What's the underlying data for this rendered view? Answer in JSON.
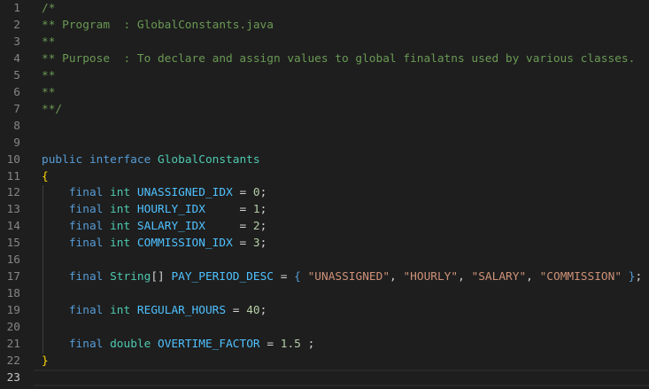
{
  "editor": {
    "active_line": 23,
    "lines": [
      [
        [
          "comment",
          "/*"
        ]
      ],
      [
        [
          "comment",
          "** Program  : GlobalConstants.java"
        ]
      ],
      [
        [
          "comment",
          "**"
        ]
      ],
      [
        [
          "comment",
          "** Purpose  : To declare and assign values to global finalatns used by various classes."
        ]
      ],
      [
        [
          "comment",
          "**"
        ]
      ],
      [
        [
          "comment",
          "**"
        ]
      ],
      [
        [
          "comment",
          "**/"
        ]
      ],
      [],
      [],
      [
        [
          "kw",
          "public"
        ],
        [
          "plain",
          " "
        ],
        [
          "kw",
          "interface"
        ],
        [
          "plain",
          " "
        ],
        [
          "type",
          "GlobalConstants"
        ]
      ],
      [
        [
          "brace",
          "{"
        ]
      ],
      [
        [
          "plain",
          "    "
        ],
        [
          "kw",
          "final"
        ],
        [
          "plain",
          " "
        ],
        [
          "type",
          "int"
        ],
        [
          "plain",
          " "
        ],
        [
          "const",
          "UNASSIGNED_IDX"
        ],
        [
          "plain",
          " = "
        ],
        [
          "num",
          "0"
        ],
        [
          "plain",
          ";"
        ]
      ],
      [
        [
          "plain",
          "    "
        ],
        [
          "kw",
          "final"
        ],
        [
          "plain",
          " "
        ],
        [
          "type",
          "int"
        ],
        [
          "plain",
          " "
        ],
        [
          "const",
          "HOURLY_IDX"
        ],
        [
          "plain",
          "     = "
        ],
        [
          "num",
          "1"
        ],
        [
          "plain",
          ";"
        ]
      ],
      [
        [
          "plain",
          "    "
        ],
        [
          "kw",
          "final"
        ],
        [
          "plain",
          " "
        ],
        [
          "type",
          "int"
        ],
        [
          "plain",
          " "
        ],
        [
          "const",
          "SALARY_IDX"
        ],
        [
          "plain",
          "     = "
        ],
        [
          "num",
          "2"
        ],
        [
          "plain",
          ";"
        ]
      ],
      [
        [
          "plain",
          "    "
        ],
        [
          "kw",
          "final"
        ],
        [
          "plain",
          " "
        ],
        [
          "type",
          "int"
        ],
        [
          "plain",
          " "
        ],
        [
          "const",
          "COMMISSION_IDX"
        ],
        [
          "plain",
          " = "
        ],
        [
          "num",
          "3"
        ],
        [
          "plain",
          ";"
        ]
      ],
      [],
      [
        [
          "plain",
          "    "
        ],
        [
          "kw",
          "final"
        ],
        [
          "plain",
          " "
        ],
        [
          "type",
          "String"
        ],
        [
          "plain",
          "[] "
        ],
        [
          "const",
          "PAY_PERIOD_DESC"
        ],
        [
          "plain",
          " = "
        ],
        [
          "kw",
          "{"
        ],
        [
          "plain",
          " "
        ],
        [
          "str",
          "\"UNASSIGNED\""
        ],
        [
          "plain",
          ", "
        ],
        [
          "str",
          "\"HOURLY\""
        ],
        [
          "plain",
          ", "
        ],
        [
          "str",
          "\"SALARY\""
        ],
        [
          "plain",
          ", "
        ],
        [
          "str",
          "\"COMMISSION\""
        ],
        [
          "plain",
          " "
        ],
        [
          "kw",
          "}"
        ],
        [
          "plain",
          ";"
        ]
      ],
      [],
      [
        [
          "plain",
          "    "
        ],
        [
          "kw",
          "final"
        ],
        [
          "plain",
          " "
        ],
        [
          "type",
          "int"
        ],
        [
          "plain",
          " "
        ],
        [
          "const",
          "REGULAR_HOURS"
        ],
        [
          "plain",
          " = "
        ],
        [
          "num",
          "40"
        ],
        [
          "plain",
          ";"
        ]
      ],
      [],
      [
        [
          "plain",
          "    "
        ],
        [
          "kw",
          "final"
        ],
        [
          "plain",
          " "
        ],
        [
          "type",
          "double"
        ],
        [
          "plain",
          " "
        ],
        [
          "const",
          "OVERTIME_FACTOR"
        ],
        [
          "plain",
          " = "
        ],
        [
          "num",
          "1.5"
        ],
        [
          "plain",
          " ;"
        ]
      ],
      [
        [
          "brace",
          "}"
        ]
      ],
      []
    ]
  }
}
